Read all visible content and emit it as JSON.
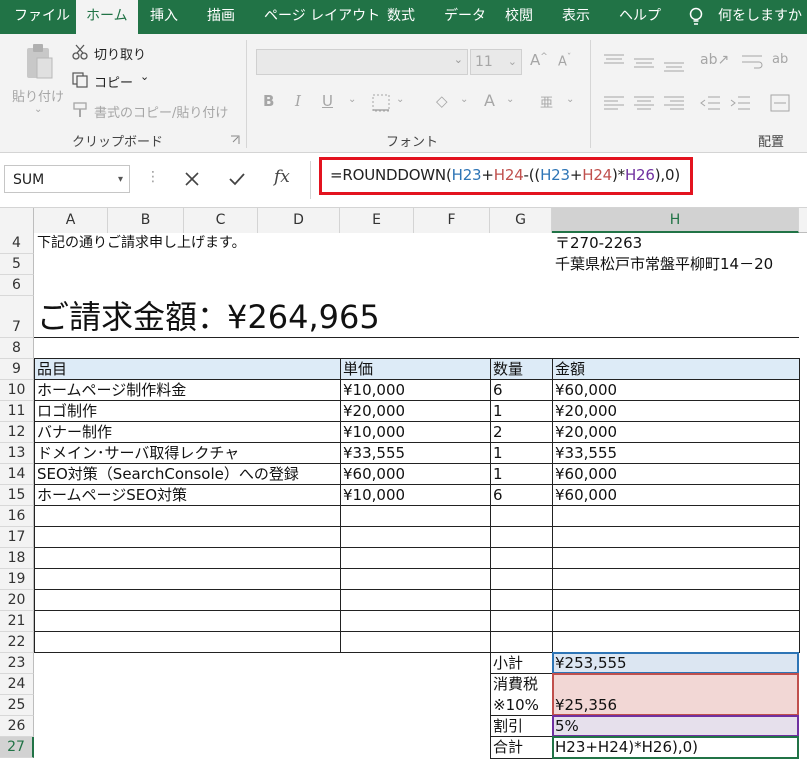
{
  "ribbon": {
    "tabs": [
      "ファイル",
      "ホーム",
      "挿入",
      "描画",
      "ページ レイアウト",
      "数式",
      "データ",
      "校閲",
      "表示",
      "ヘルプ",
      "何をしますか"
    ],
    "clipboard": {
      "paste": "貼り付け",
      "cut": "切り取り",
      "copy": "コピー",
      "format_painter": "書式のコピー/貼り付け",
      "group_label": "クリップボード"
    },
    "font": {
      "size": "11",
      "group_label": "フォント"
    },
    "alignment": {
      "group_label": "配置"
    }
  },
  "formula_bar": {
    "name_box": "SUM",
    "formula": "=ROUNDDOWN(H23+H24-((H23+H24)*H26),0)"
  },
  "grid": {
    "columns": [
      "A",
      "B",
      "C",
      "D",
      "E",
      "F",
      "G",
      "H"
    ],
    "rows": [
      "4",
      "5",
      "6",
      "7",
      "8",
      "9",
      "10",
      "11",
      "12",
      "13",
      "14",
      "15",
      "16",
      "17",
      "18",
      "19",
      "20",
      "21",
      "22",
      "23",
      "24",
      "25",
      "26",
      "27"
    ]
  },
  "invoice": {
    "intro": "下記の通りご請求申し上げます。",
    "postal": "〒270-2263",
    "address": "千葉県松戸市常盤平柳町14－20",
    "total_label": "ご請求金額：",
    "total_value": "¥264,965",
    "headers": {
      "item": "品目",
      "unit_price": "単価",
      "qty": "数量",
      "amount": "金額"
    },
    "items": [
      {
        "item": "ホームページ制作料金",
        "unit_price": "¥10,000",
        "qty": "6",
        "amount": "¥60,000"
      },
      {
        "item": "ロゴ制作",
        "unit_price": "¥20,000",
        "qty": "1",
        "amount": "¥20,000"
      },
      {
        "item": "バナー制作",
        "unit_price": "¥10,000",
        "qty": "2",
        "amount": "¥20,000"
      },
      {
        "item": "ドメイン･サーバ取得レクチャ",
        "unit_price": "¥33,555",
        "qty": "1",
        "amount": "¥33,555"
      },
      {
        "item": "SEO対策（SearchConsole）への登録",
        "unit_price": "¥60,000",
        "qty": "1",
        "amount": "¥60,000"
      },
      {
        "item": "ホームページSEO対策",
        "unit_price": "¥10,000",
        "qty": "6",
        "amount": "¥60,000"
      }
    ],
    "summary": {
      "subtotal_label": "小計",
      "subtotal_value": "¥253,555",
      "tax_label": "消費税",
      "tax_rate_label": "※10%",
      "tax_value": "¥25,356",
      "discount_label": "割引",
      "discount_value": "5%",
      "total_label": "合計",
      "total_editing": "H23+H24)*H26),0)"
    }
  },
  "colors": {
    "ribbon_green": "#217346",
    "highlight_red": "#e3131f",
    "ref_blue": "#2e75b6",
    "ref_red": "#c0504d",
    "ref_purple": "#7030a0",
    "header_fill": "#ddebf7",
    "subtotal_fill": "#dce6f2",
    "tax_fill": "#f2d7d5",
    "discount_fill": "#e6e0ec"
  }
}
